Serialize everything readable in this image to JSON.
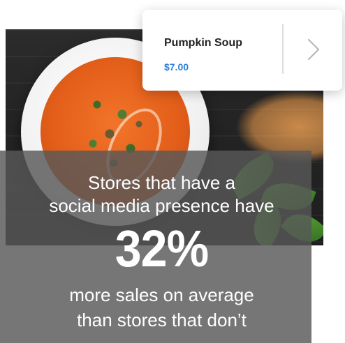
{
  "product_card": {
    "name": "Pumpkin Soup",
    "price": "$7.00",
    "price_color": "#2f7fd8",
    "next_icon": "chevron-right-icon"
  },
  "stat": {
    "lead": "Stores that have a\nsocial media presence have",
    "number": "32%",
    "tail": "more sales on average\nthan stores that don’t"
  },
  "photo": {
    "subject": "pumpkin-soup-photo"
  }
}
